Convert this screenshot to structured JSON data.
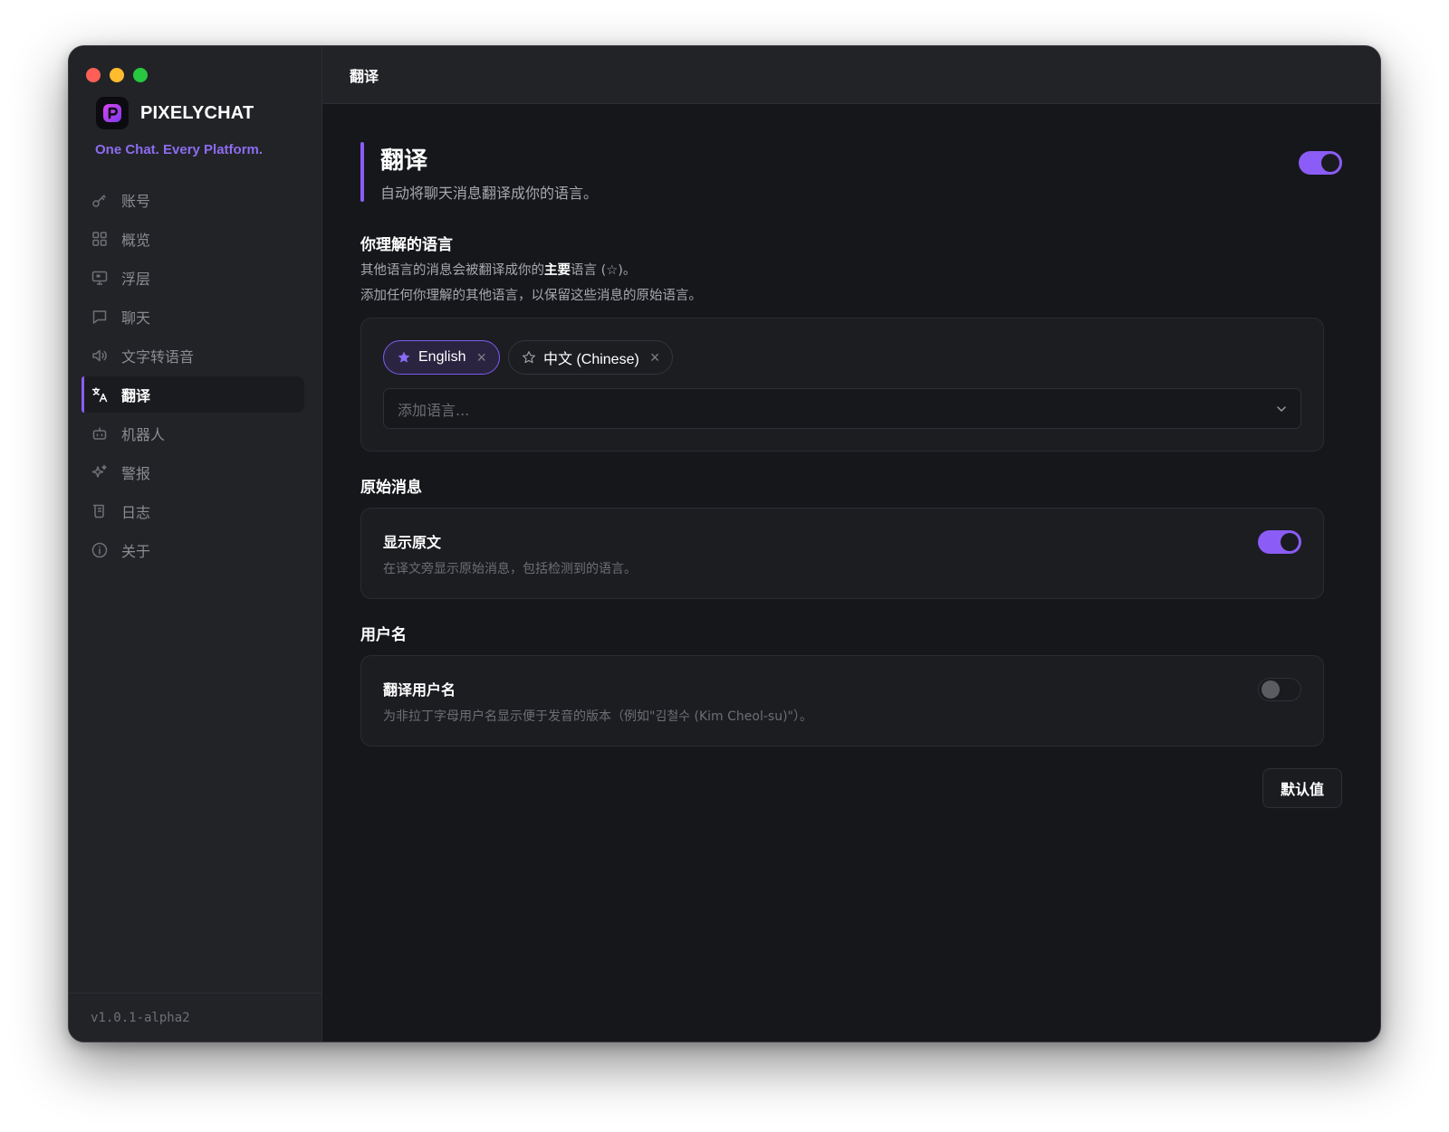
{
  "app": {
    "brand_name": "PIXELYCHAT",
    "tagline": "One Chat. Every Platform.",
    "version": "v1.0.1-alpha2",
    "accent_color": "#8b5cf6"
  },
  "sidebar": {
    "items": [
      {
        "label": "账号",
        "icon": "key-icon"
      },
      {
        "label": "概览",
        "icon": "grid-icon"
      },
      {
        "label": "浮层",
        "icon": "monitor-icon"
      },
      {
        "label": "聊天",
        "icon": "chat-bubble-icon"
      },
      {
        "label": "文字转语音",
        "icon": "speaker-icon"
      },
      {
        "label": "翻译",
        "icon": "translate-icon",
        "active": true
      },
      {
        "label": "机器人",
        "icon": "bot-icon"
      },
      {
        "label": "警报",
        "icon": "sparkle-icon"
      },
      {
        "label": "日志",
        "icon": "scroll-icon"
      },
      {
        "label": "关于",
        "icon": "info-icon"
      }
    ]
  },
  "header": {
    "title": "翻译"
  },
  "main": {
    "title": "翻译",
    "subtitle": "自动将聊天消息翻译成你的语言。",
    "enabled": true,
    "languages": {
      "heading": "你理解的语言",
      "desc1_pre": "其他语言的消息会被翻译成你的",
      "desc1_bold": "主要",
      "desc1_post": "语言 (☆)。",
      "desc2": "添加任何你理解的其他语言，以保留这些消息的原始语言。",
      "chips": [
        {
          "label": "English",
          "primary": true
        },
        {
          "label": "中文 (Chinese)",
          "primary": false
        }
      ],
      "add_placeholder": "添加语言..."
    },
    "original": {
      "heading": "原始消息",
      "row_title": "显示原文",
      "row_desc": "在译文旁显示原始消息，包括检测到的语言。",
      "enabled": true
    },
    "username": {
      "heading": "用户名",
      "row_title": "翻译用户名",
      "row_desc": "为非拉丁字母用户名显示便于发音的版本（例如\"김철수 (Kim Cheol-su)\"）。",
      "enabled": false
    },
    "defaults_button": "默认值"
  }
}
